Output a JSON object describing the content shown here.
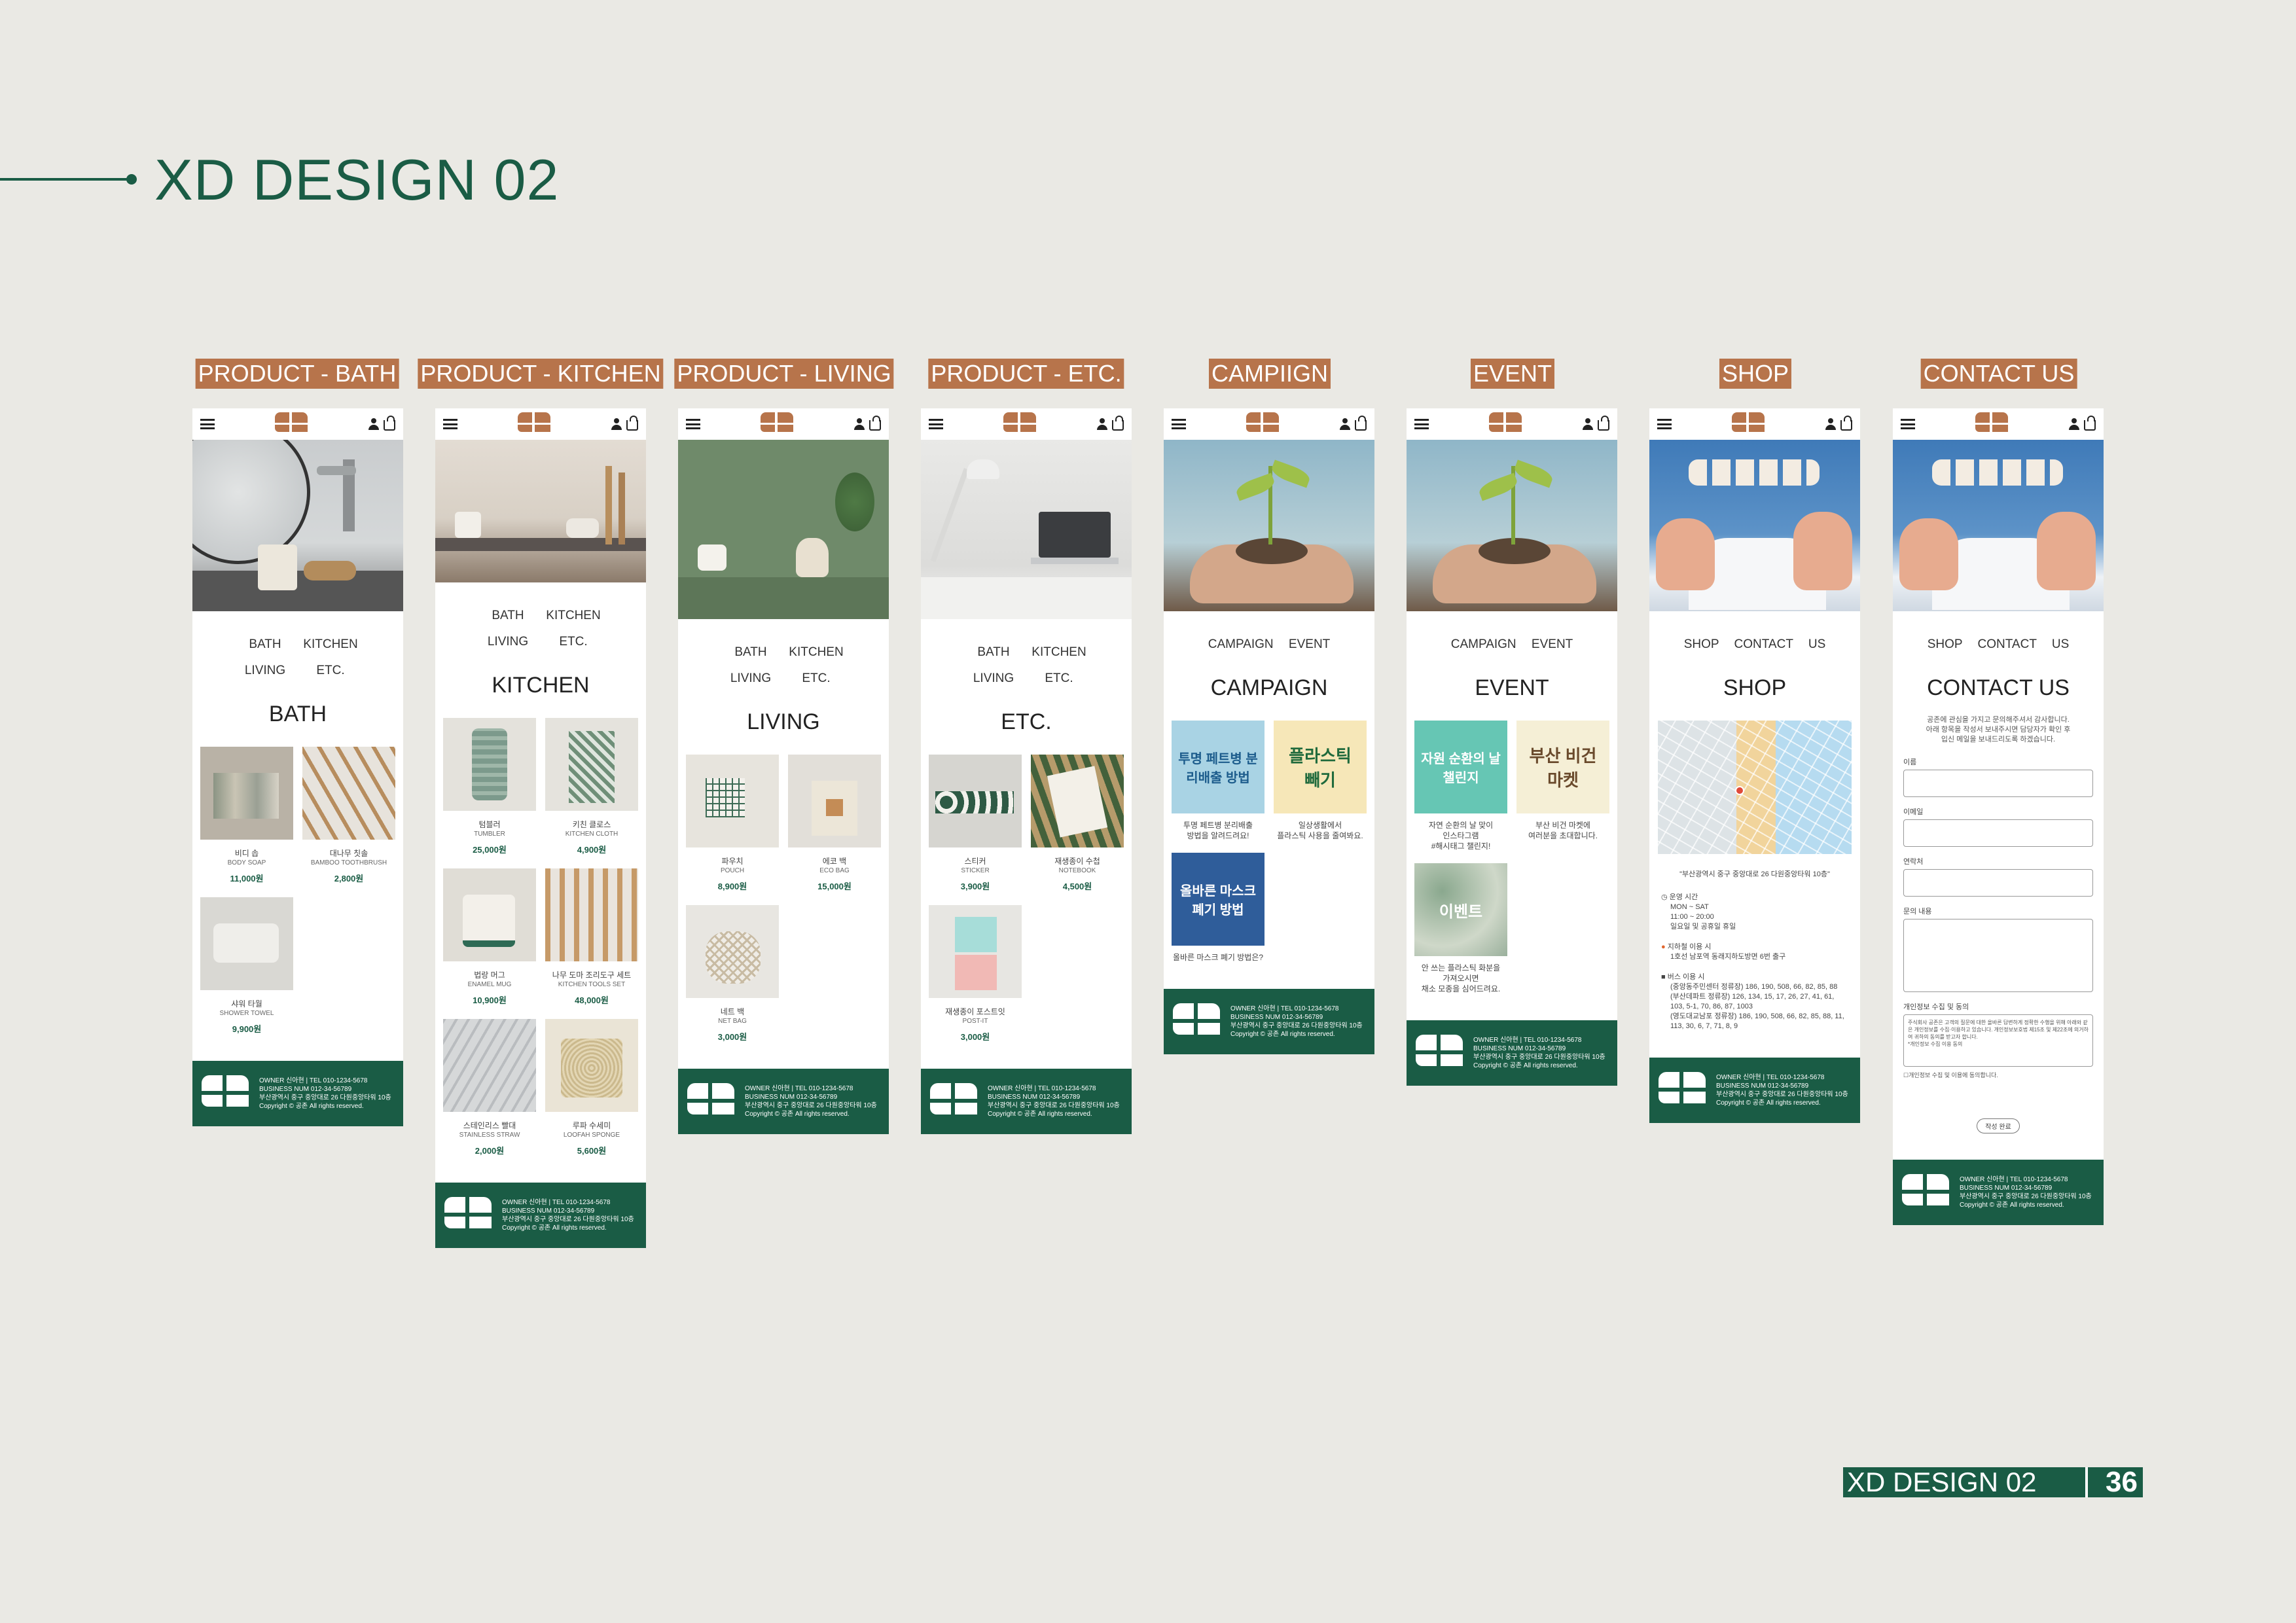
{
  "header": {
    "title": "XD DESIGN 02"
  },
  "labels": [
    "PRODUCT - BATH",
    "PRODUCT - KITCHEN",
    "PRODUCT - LIVING",
    "PRODUCT - ETC.",
    "CAMPIIGN",
    "EVENT",
    "SHOP",
    "CONTACT US"
  ],
  "catnav": {
    "bath": "BATH",
    "kitchen": "KITCHEN",
    "living": "LIVING",
    "etc": "ETC."
  },
  "bath": {
    "title": "BATH",
    "items": [
      {
        "kn": "비디 솝",
        "en": "BODY SOAP",
        "price": "11,000원"
      },
      {
        "kn": "대나무 칫솔",
        "en": "BAMBOO TOOTHBRUSH",
        "price": "2,800원"
      },
      {
        "kn": "샤워 타월",
        "en": "SHOWER TOWEL",
        "price": "9,900원"
      }
    ]
  },
  "kitchen": {
    "title": "KITCHEN",
    "items": [
      {
        "kn": "텀블러",
        "en": "TUMBLER",
        "price": "25,000원"
      },
      {
        "kn": "키친 클로스",
        "en": "KITCHEN CLOTH",
        "price": "4,900원"
      },
      {
        "kn": "법랑 머그",
        "en": "ENAMEL MUG",
        "price": "10,900원"
      },
      {
        "kn": "나무 도마 조리도구 세트",
        "en": "KITCHEN TOOLS SET",
        "price": "48,000원"
      },
      {
        "kn": "스테인리스 빨대",
        "en": "STAINLESS STRAW",
        "price": "2,000원"
      },
      {
        "kn": "루파 수세미",
        "en": "LOOFAH SPONGE",
        "price": "5,600원"
      }
    ]
  },
  "living": {
    "title": "LIVING",
    "items": [
      {
        "kn": "파우치",
        "en": "POUCH",
        "price": "8,900원"
      },
      {
        "kn": "에코 백",
        "en": "ECO BAG",
        "price": "15,000원"
      },
      {
        "kn": "네트 백",
        "en": "NET BAG",
        "price": "3,000원"
      }
    ]
  },
  "etc": {
    "title": "ETC.",
    "items": [
      {
        "kn": "스티커",
        "en": "STICKER",
        "price": "3,900원"
      },
      {
        "kn": "재생종이 수첩",
        "en": "NOTEBOOK",
        "price": "4,500원"
      },
      {
        "kn": "재생종이 포스트잇",
        "en": "POST-IT",
        "price": "3,000원"
      }
    ]
  },
  "campaign": {
    "nav": "CAMPAIGN EVENT",
    "title": "CAMPAIGN",
    "items": [
      {
        "img": "투명 페트병 분리배출 방법",
        "desc": "투명 페트병 분리배출\n방법을 알려드려요!"
      },
      {
        "img": "플라스틱 빼기",
        "desc": "일상생활에서\n플라스틱 사용을 줄여봐요."
      },
      {
        "img": "올바른 마스크 폐기 방법",
        "desc": "올바른 마스크 폐기 방법은?"
      }
    ]
  },
  "event": {
    "nav": "CAMPAIGN EVENT",
    "title": "EVENT",
    "items": [
      {
        "img": "자원 순환의 날 챌린지",
        "desc": "자연 순환의 날 맞이\n인스타그램\n#해시태그 챌린지!"
      },
      {
        "img": "부산 비건 마켓",
        "desc": "부산 비건 마켓에\n여러분을 초대합니다."
      },
      {
        "img": "이벤트",
        "desc": "안 쓰는 플라스틱 화분을\n가져오시면\n채소 모종을 심어드려요."
      }
    ]
  },
  "shop": {
    "nav": "SHOP CONTACT US",
    "title": "SHOP",
    "address": "\"부산광역시 중구 중앙대로 26 다원중앙타워 10층\"",
    "hours_label": "운영 시간",
    "hours": "MON ~ SAT\n11:00 ~ 20:00\n일요일 및 공휴일 휴일",
    "subway_label": "지하철 이용 시",
    "subway": "1호선 남포역 동래지하도방면 6번 출구",
    "bus_label": "버스 이용 시",
    "bus": "(중앙동주민센터 정류장) 186, 190, 508, 66, 82, 85, 88\n(부산데파트 정류장) 126, 134, 15, 17, 26, 27, 41, 61, 103, 5-1, 70, 86, 87, 1003\n(영도대교남포 정류장) 186, 190, 508, 66, 82, 85, 88, 11, 113, 30, 6, 7, 71, 8, 9"
  },
  "contact": {
    "nav": "SHOP CONTACT US",
    "title": "CONTACT US",
    "intro": "공존에 관심을 가지고 문의해주셔서 감사합니다.\n아래 항목을 작성서 보내주시면 담당자가 확인 후\n입신 메일을 보내드리도록 하겠습니다.",
    "name": "이름",
    "email": "이메일",
    "phone": "연락처",
    "message": "문의 내용",
    "privacy": "개인정보 수집 및 동의",
    "privacy_text": "주식회사 공존은 고객의 질문에 대한 올바른 답변하게 정확한 수행을 위해 아래와 같은 개인정보를 수집·이용하고 있습니다. 개인정보보호법 제15조 및 제22조에 의거하여 귀하의 동의를 받고자 합니다.\n*개인정보 수집 이용 동의",
    "agree": "개인정보 수집 및 이용에 동의합니다.",
    "submit": "작성 완료"
  },
  "footer": {
    "line1": "OWNER 신아현 | TEL 010-1234-5678",
    "line2": "BUSINESS NUM 012-34-56789",
    "line3": "부산광역시 중구 중앙대로 26 다원중앙타워 10층",
    "line4": "Copyright © 공존 All rights reserved."
  },
  "page": {
    "badge": "XD DESIGN 02",
    "number": "36"
  },
  "colors": {
    "accent": "#1a5c45",
    "label_bg": "#b7744b",
    "background": "#eae9e4"
  }
}
